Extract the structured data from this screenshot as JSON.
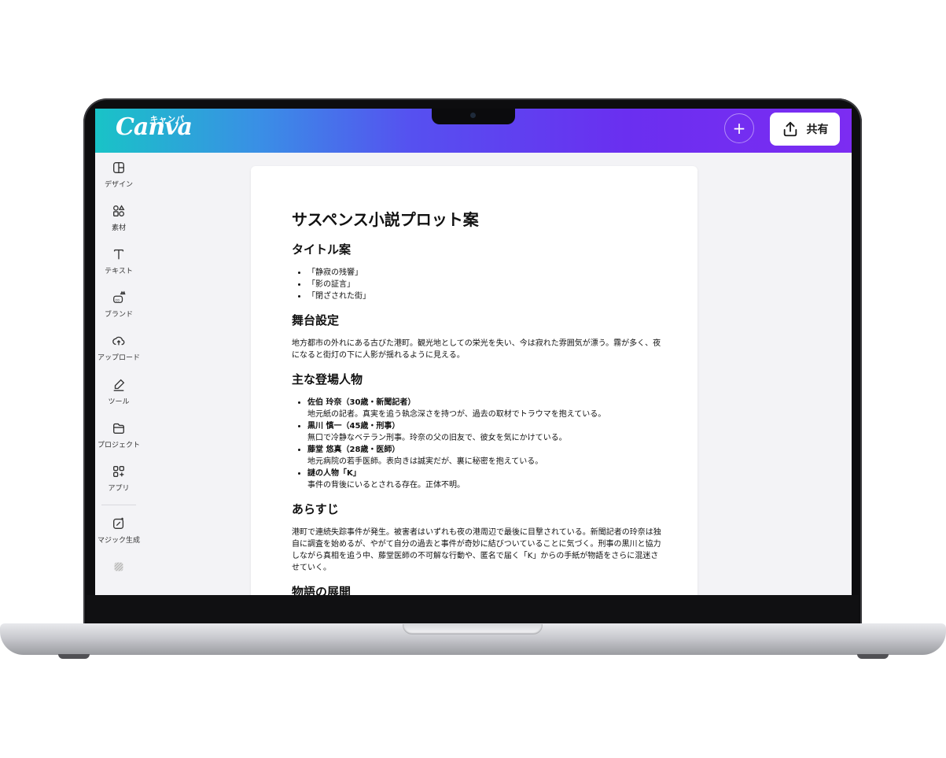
{
  "app": {
    "logo": "Canva",
    "logo_kana": "キャンパ",
    "share_label": "共有",
    "accent_gradient": [
      "#19c3c7",
      "#5650f0",
      "#7c2cf2"
    ]
  },
  "sidebar": {
    "items": [
      {
        "label": "デザイン",
        "icon": "design-icon"
      },
      {
        "label": "素材",
        "icon": "elements-icon"
      },
      {
        "label": "テキスト",
        "icon": "text-icon"
      },
      {
        "label": "ブランド",
        "icon": "brand-icon"
      },
      {
        "label": "アップロード",
        "icon": "upload-icon"
      },
      {
        "label": "ツール",
        "icon": "tools-icon"
      },
      {
        "label": "プロジェクト",
        "icon": "folder-icon"
      },
      {
        "label": "アプリ",
        "icon": "apps-icon"
      },
      {
        "label": "マジック生成",
        "icon": "magic-icon"
      }
    ]
  },
  "document": {
    "title": "サスペンス小説プロット案",
    "sections": {
      "titles": {
        "heading": "タイトル案",
        "items": [
          "「静寂の残響」",
          "「影の証言」",
          "「閉ざされた街」"
        ]
      },
      "setting": {
        "heading": "舞台設定",
        "body": "地方都市の外れにある古びた港町。観光地としての栄光を失い、今は寂れた雰囲気が漂う。霧が多く、夜になると街灯の下に人影が揺れるように見える。"
      },
      "characters": {
        "heading": "主な登場人物",
        "items": [
          {
            "name": "佐伯 玲奈（30歳・新聞記者）",
            "desc": "地元紙の記者。真実を追う執念深さを持つが、過去の取材でトラウマを抱えている。"
          },
          {
            "name": "黒川 慎一（45歳・刑事）",
            "desc": "無口で冷静なベテラン刑事。玲奈の父の旧友で、彼女を気にかけている。"
          },
          {
            "name": "藤堂 悠真（28歳・医師）",
            "desc": "地元病院の若手医師。表向きは誠実だが、裏に秘密を抱えている。"
          },
          {
            "name": "謎の人物「K」",
            "desc": "事件の背後にいるとされる存在。正体不明。"
          }
        ]
      },
      "synopsis": {
        "heading": "あらすじ",
        "body": "港町で連続失踪事件が発生。被害者はいずれも夜の港周辺で最後に目撃されている。新聞記者の玲奈は独自に調査を始めるが、やがて自分の過去と事件が奇妙に結びついていることに気づく。刑事の黒川と協力しながら真相を追う中、藤堂医師の不可解な行動や、匿名で届く「K」からの手紙が物語をさらに混迷させていく。"
      },
      "development": {
        "heading": "物語の展開"
      }
    }
  }
}
